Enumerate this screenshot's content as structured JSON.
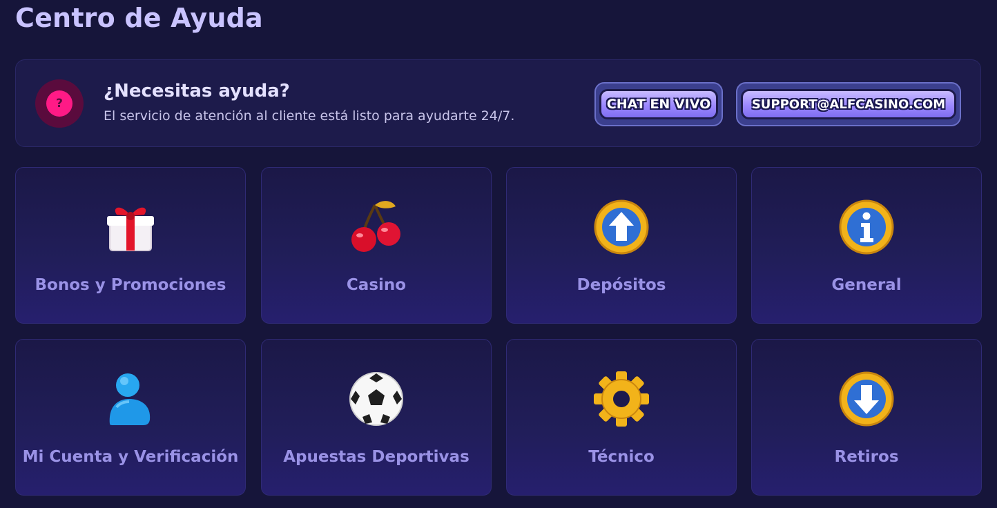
{
  "page": {
    "title": "Centro de Ayuda"
  },
  "help_banner": {
    "icon": "question-icon",
    "icon_glyph": "?",
    "heading": "¿Necesitas ayuda?",
    "subtitle": "El servicio de atención al cliente está listo para ayudarte 24/7.",
    "chat_button_label": "CHAT EN VIVO",
    "email_button_label": "SUPPORT@ALFCASINO.COM"
  },
  "categories": [
    {
      "label": "Bonos y Promociones",
      "icon": "gift-icon"
    },
    {
      "label": "Casino",
      "icon": "cherry-icon"
    },
    {
      "label": "Depósitos",
      "icon": "arrow-up-coin-icon"
    },
    {
      "label": "General",
      "icon": "info-coin-icon"
    },
    {
      "label": "Mi Cuenta y Verificación",
      "icon": "user-icon"
    },
    {
      "label": "Apuestas Deportivas",
      "icon": "soccer-ball-icon"
    },
    {
      "label": "Técnico",
      "icon": "gear-icon"
    },
    {
      "label": "Retiros",
      "icon": "arrow-down-coin-icon"
    }
  ],
  "colors": {
    "background": "#16153a",
    "card": "#211e5a",
    "accent": "#9c88ff",
    "label": "#9a92e6",
    "title": "#c9c3ff",
    "help_pink": "#ff1a86"
  }
}
